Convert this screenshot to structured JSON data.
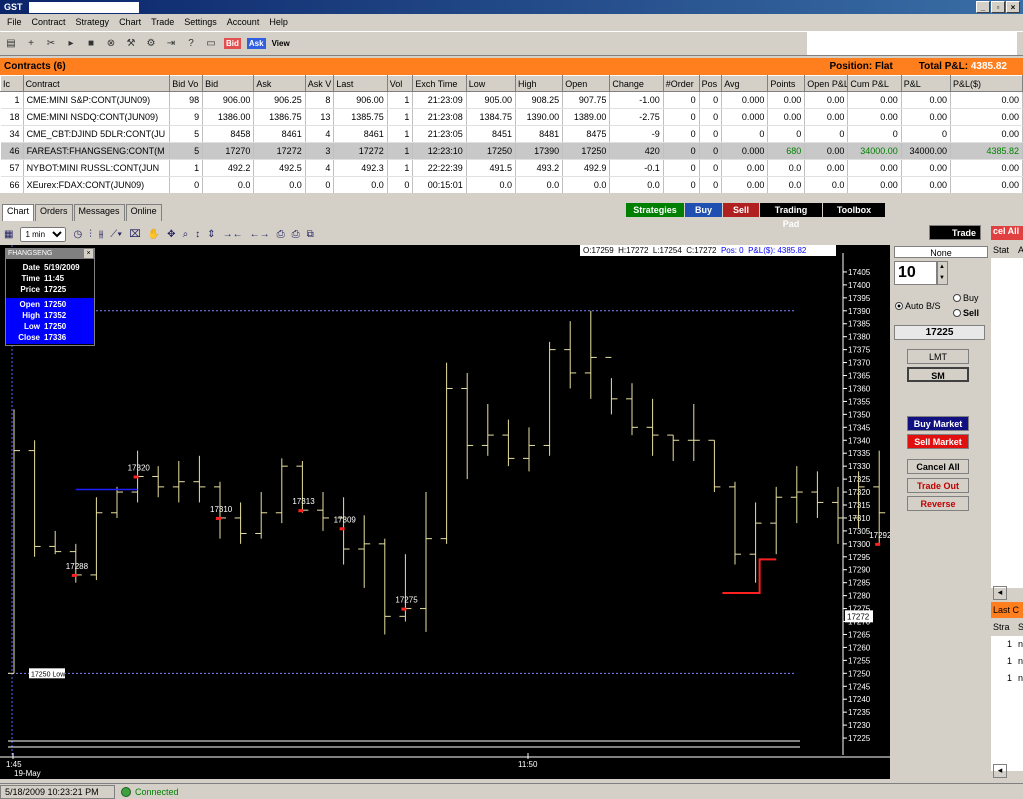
{
  "window": {
    "title": "GST"
  },
  "menu": [
    "File",
    "Contract",
    "Strategy",
    "Chart",
    "Trade",
    "Settings",
    "Account",
    "Help"
  ],
  "toolbar": {
    "bid": "Bid",
    "ask": "Ask",
    "view": "View"
  },
  "contracts": {
    "title": "Contracts (6)",
    "position_label": "Position:",
    "position_value": "Flat",
    "total_pnl_label": "Total P&L:",
    "total_pnl_value": "4385.82",
    "columns": [
      "Ic",
      "Contract",
      "Bid Vo",
      "Bid",
      "Ask",
      "Ask V",
      "Last",
      "Vol",
      "Exch Time",
      "Low",
      "High",
      "Open",
      "Change",
      "#Order",
      "Pos",
      "Avg",
      "Points",
      "Open P&L",
      "Cum P&L",
      "P&L",
      "P&L($)"
    ],
    "rows": [
      [
        "1",
        "CME:MINI S&P:CONT(JUN09)",
        "98",
        "906.00",
        "906.25",
        "8",
        "906.00",
        "1",
        "21:23:09",
        "905.00",
        "908.25",
        "907.75",
        "-1.00",
        "0",
        "0",
        "0.000",
        "0.00",
        "0.00",
        "0.00",
        "0.00",
        "0.00"
      ],
      [
        "18",
        "CME:MINI NSDQ:CONT(JUN09)",
        "9",
        "1386.00",
        "1386.75",
        "13",
        "1385.75",
        "1",
        "21:23:08",
        "1384.75",
        "1390.00",
        "1389.00",
        "-2.75",
        "0",
        "0",
        "0.000",
        "0.00",
        "0.00",
        "0.00",
        "0.00",
        "0.00"
      ],
      [
        "34",
        "CME_CBT:DJIND 5DLR:CONT(JU",
        "5",
        "8458",
        "8461",
        "4",
        "8461",
        "1",
        "21:23:05",
        "8451",
        "8481",
        "8475",
        "-9",
        "0",
        "0",
        "0",
        "0",
        "0",
        "0",
        "0",
        "0.00"
      ],
      [
        "46",
        "FAREAST:FHANGSENG:CONT(M",
        "5",
        "17270",
        "17272",
        "3",
        "17272",
        "1",
        "12:23:10",
        "17250",
        "17390",
        "17250",
        "420",
        "0",
        "0",
        "0.000",
        "680",
        "0.00",
        "34000.00",
        "34000.00",
        "4385.82"
      ],
      [
        "57",
        "NYBOT:MINI RUSSL:CONT(JUN",
        "1",
        "492.2",
        "492.5",
        "4",
        "492.3",
        "1",
        "22:22:39",
        "491.5",
        "493.2",
        "492.9",
        "-0.1",
        "0",
        "0",
        "0.00",
        "0.0",
        "0.00",
        "0.00",
        "0.00",
        "0.00"
      ],
      [
        "66",
        "XEurex:FDAX:CONT(JUN09)",
        "0",
        "0.0",
        "0.0",
        "0",
        "0.0",
        "0",
        "00:15:01",
        "0.0",
        "0.0",
        "0.0",
        "0.0",
        "0",
        "0",
        "0.00",
        "0.0",
        "0.0",
        "0.00",
        "0.00",
        "0.00"
      ]
    ]
  },
  "tabs": [
    "Chart",
    "Orders",
    "Messages",
    "Online"
  ],
  "action_buttons": [
    {
      "label": "Strategies",
      "color": "#008000"
    },
    {
      "label": "Buy",
      "color": "#1f4fb0"
    },
    {
      "label": "Sell",
      "color": "#b02020"
    },
    {
      "label": "Trading Pad",
      "color": "#000000"
    },
    {
      "label": "Toolbox",
      "color": "#000000"
    }
  ],
  "chart_toolbar": {
    "interval": "1 min"
  },
  "info_box": {
    "symbol": "FHANGSENG",
    "date_label": "Date",
    "date": "5/19/2009",
    "time_label": "Time",
    "time": "11:45",
    "price_label": "Price",
    "price": "17225",
    "open_label": "Open",
    "open": "17250",
    "high_label": "High",
    "high": "17352",
    "low_label": "Low",
    "low": "17250",
    "close_label": "Close",
    "close": "17336"
  },
  "ohlc_bar": {
    "o": "O:17259",
    "h": "H:17272",
    "l": "L:17254",
    "c": "C:17272",
    "pos": "Pos: 0",
    "pnl": "P&L($): 4385.82"
  },
  "chart_data": {
    "type": "ohlc",
    "symbol": "FHANGSENG",
    "ylim": [
      17220,
      17410
    ],
    "y_ticks": [
      17405,
      17400,
      17395,
      17390,
      17385,
      17380,
      17375,
      17370,
      17365,
      17360,
      17355,
      17350,
      17345,
      17340,
      17335,
      17330,
      17325,
      17320,
      17315,
      17310,
      17305,
      17300,
      17295,
      17290,
      17285,
      17280,
      17275,
      17270,
      17265,
      17260,
      17255,
      17250,
      17245,
      17240,
      17235,
      17230,
      17225
    ],
    "x_ticks": [
      {
        "label": "1:45",
        "minute": 0
      },
      {
        "label": "11:50",
        "minute": 5
      },
      {
        "label": "11:55",
        "minute": 10
      },
      {
        "label": "12:00",
        "minute": 15
      },
      {
        "label": "12:05",
        "minute": 20
      },
      {
        "label": "12:10",
        "minute": 25
      },
      {
        "label": "12:15",
        "minute": 30
      },
      {
        "label": "12:20",
        "minute": 35
      }
    ],
    "date_label": "19-May",
    "bars": [
      [
        17250,
        17352,
        17250,
        17336
      ],
      [
        17336,
        17340,
        17295,
        17299
      ],
      [
        17299,
        17305,
        17296,
        17297
      ],
      [
        17297,
        17300,
        17285,
        17288
      ],
      [
        17288,
        17318,
        17286,
        17312
      ],
      [
        17312,
        17322,
        17310,
        17320
      ],
      [
        17320,
        17336,
        17316,
        17326
      ],
      [
        17326,
        17330,
        17318,
        17322
      ],
      [
        17322,
        17332,
        17316,
        17324
      ],
      [
        17324,
        17334,
        17316,
        17322
      ],
      [
        17322,
        17324,
        17302,
        17310
      ],
      [
        17310,
        17316,
        17300,
        17304
      ],
      [
        17304,
        17320,
        17302,
        17312
      ],
      [
        17312,
        17333,
        17308,
        17330
      ],
      [
        17330,
        17332,
        17312,
        17313
      ],
      [
        17313,
        17320,
        17305,
        17310
      ],
      [
        17310,
        17318,
        17292,
        17298
      ],
      [
        17298,
        17311,
        17283,
        17300
      ],
      [
        17300,
        17302,
        17265,
        17272
      ],
      [
        17272,
        17296,
        17270,
        17275
      ],
      [
        17275,
        17320,
        17266,
        17302
      ],
      [
        17302,
        17370,
        17300,
        17360
      ],
      [
        17360,
        17366,
        17325,
        17338
      ],
      [
        17338,
        17354,
        17334,
        17342
      ],
      [
        17342,
        17348,
        17330,
        17333
      ],
      [
        17333,
        17345,
        17328,
        17338
      ],
      [
        17338,
        17378,
        17334,
        17375
      ],
      [
        17375,
        17386,
        17360,
        17366
      ],
      [
        17366,
        17390,
        17356,
        17372
      ],
      [
        17372,
        17364,
        17350,
        17356
      ],
      [
        17356,
        17362,
        17342,
        17345
      ],
      [
        17345,
        17356,
        17334,
        17342
      ],
      [
        17342,
        17342,
        17332,
        17340
      ],
      [
        17340,
        17354,
        17332,
        17340
      ],
      [
        17340,
        17340,
        17320,
        17322
      ],
      [
        17322,
        17324,
        17292,
        17296
      ],
      [
        17296,
        17316,
        17285,
        17308
      ],
      [
        17308,
        17322,
        17296,
        17318
      ],
      [
        17318,
        17330,
        17308,
        17320
      ],
      [
        17320,
        17328,
        17310,
        17316
      ],
      [
        17316,
        17322,
        17300,
        17310
      ],
      [
        17310,
        17328,
        17306,
        17322
      ],
      [
        17322,
        17336,
        17300,
        17312
      ],
      [
        17312,
        17330,
        17292,
        17300
      ],
      [
        17300,
        17296,
        17250,
        17260
      ],
      [
        17259,
        17272,
        17254,
        17272
      ]
    ],
    "level_lines": [
      {
        "label": "17250 Low",
        "value": 17250
      },
      {
        "value": 17390
      }
    ],
    "last_price": "17272",
    "trade_labels": [
      {
        "text": "17288",
        "bar": 3,
        "value": 17288
      },
      {
        "text": "17320",
        "bar": 6,
        "value": 17326
      },
      {
        "text": "17310",
        "bar": 10,
        "value": 17310
      },
      {
        "text": "17313",
        "bar": 14,
        "value": 17313
      },
      {
        "text": "17309",
        "bar": 16,
        "value": 17306
      },
      {
        "text": "17275",
        "bar": 19,
        "value": 17275
      },
      {
        "text": "17292",
        "bar": 42,
        "value": 17300
      },
      {
        "text": "17255",
        "bar": 45,
        "value": 17257
      }
    ]
  },
  "trade_panel": {
    "header": "Trade",
    "order_type": "None",
    "qty": "10",
    "auto_label": "Auto B/S",
    "buy_label": "Buy",
    "sell_label": "Sell",
    "price": "17225",
    "lmt": "LMT",
    "sm": "SM",
    "buy_market": "Buy Market",
    "sell_market": "Sell Market",
    "cancel_all": "Cancel All",
    "trade_out": "Trade Out",
    "reverse": "Reverse"
  },
  "right_panel": {
    "cancel_all": "cel All",
    "col1": "Stat",
    "col2": "A",
    "last": "Last C",
    "stra": "Stra",
    "s": "S",
    "rows": [
      "1",
      "1",
      "1"
    ],
    "rowvals": [
      "n",
      "n",
      "n"
    ]
  },
  "status": {
    "datetime": "5/18/2009 10:23:21 PM",
    "connected": "Connected"
  }
}
